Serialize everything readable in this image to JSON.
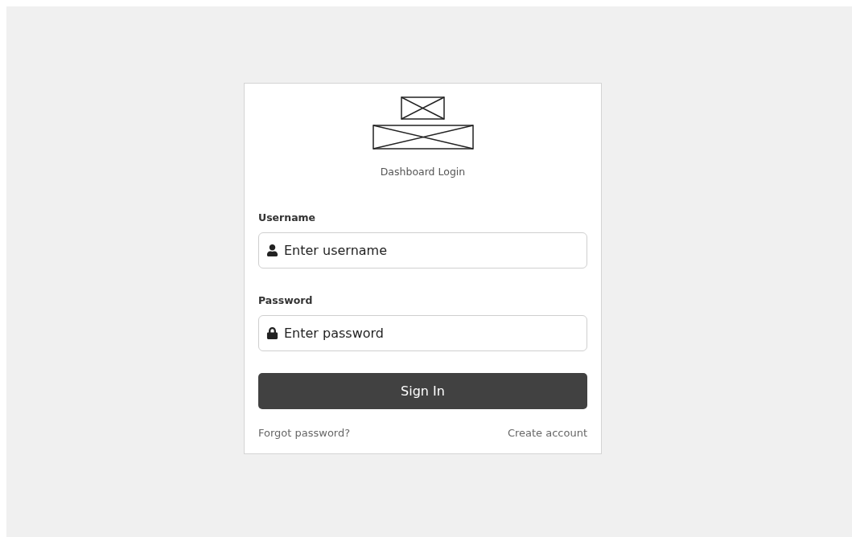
{
  "login_card": {
    "title": "Dashboard Login",
    "fields": [
      {
        "label": "Username",
        "placeholder": "Enter username",
        "kind": "user"
      },
      {
        "label": "Password",
        "placeholder": "Enter password",
        "kind": "password"
      }
    ],
    "submit": "Sign In",
    "links": [
      "Forgot password?",
      "Create account"
    ]
  }
}
